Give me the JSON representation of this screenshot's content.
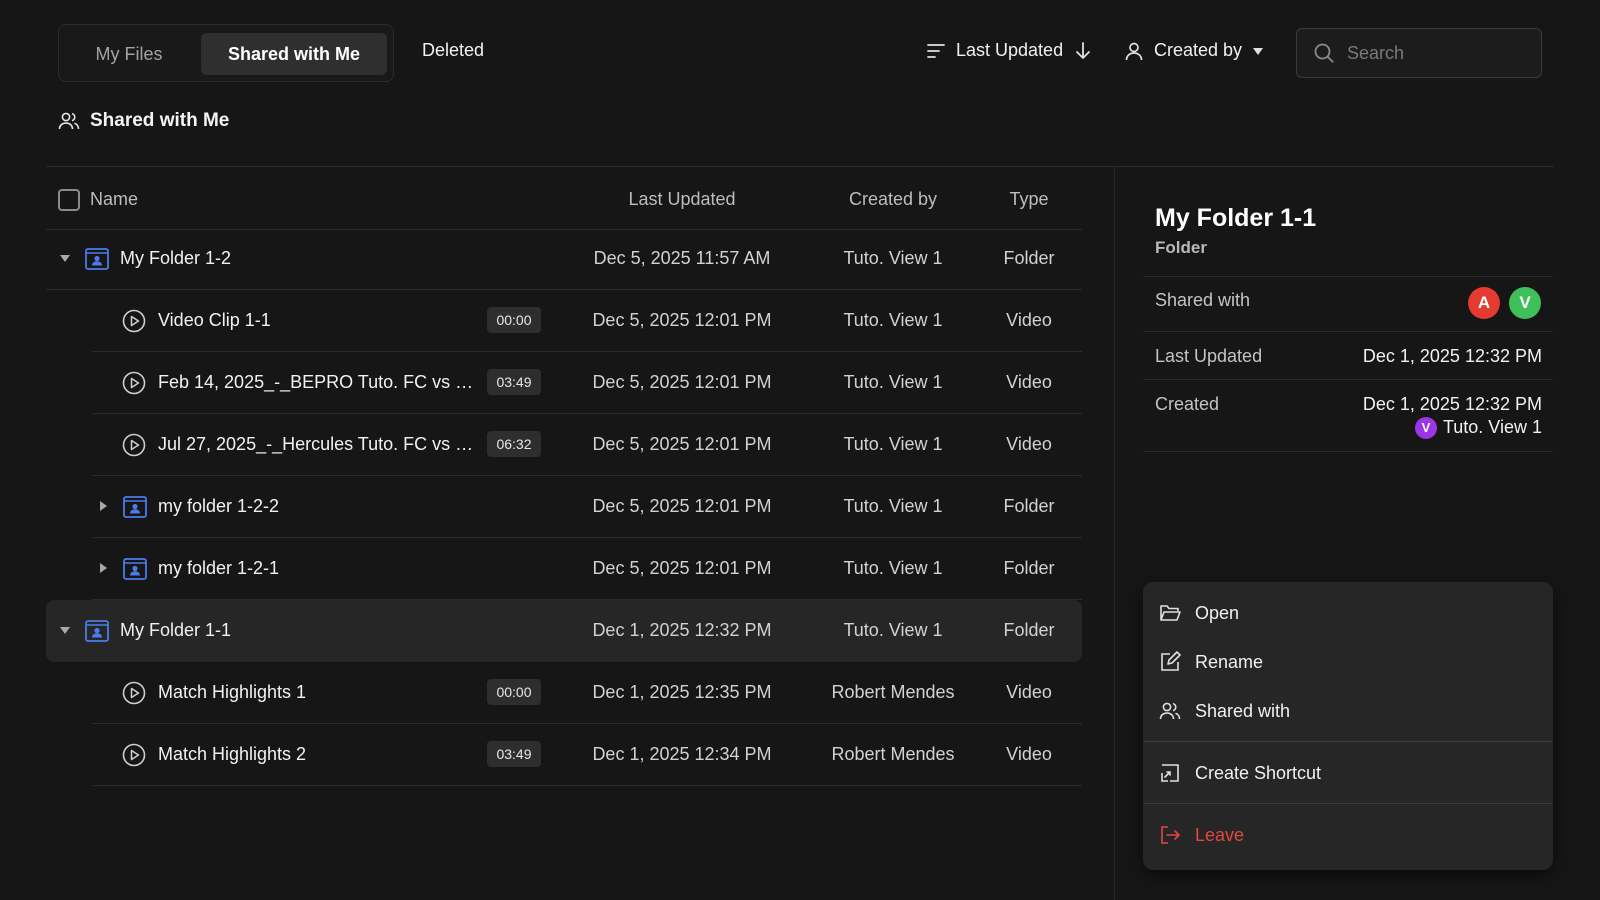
{
  "tabs": [
    {
      "label": "My Files",
      "active": false
    },
    {
      "label": "Shared with Me",
      "active": true
    },
    {
      "label": "Deleted",
      "active": false
    }
  ],
  "toolbar": {
    "sort_label": "Last Updated",
    "created_by_label": "Created by",
    "search_placeholder": "Search"
  },
  "section_title": "Shared with Me",
  "table": {
    "headers": {
      "name": "Name",
      "last_updated": "Last Updated",
      "created_by": "Created by",
      "type": "Type"
    },
    "rows": [
      {
        "name": "My Folder 1-2",
        "kind": "folder",
        "expanded": true,
        "duration": "",
        "last_updated": "Dec 5, 2025 11:57 AM",
        "created_by": "Tuto. View 1",
        "type": "Folder"
      },
      {
        "name": "Video Clip 1-1",
        "kind": "video",
        "duration": "00:00",
        "last_updated": "Dec 5, 2025 12:01 PM",
        "created_by": "Tuto. View 1",
        "type": "Video"
      },
      {
        "name": "Feb 14, 2025_-_BEPRO Tuto. FC vs Cerb...",
        "kind": "video",
        "duration": "03:49",
        "last_updated": "Dec 5, 2025 12:01 PM",
        "created_by": "Tuto. View 1",
        "type": "Video"
      },
      {
        "name": "Jul 27, 2025_-_Hercules Tuto. FC vs BE...",
        "kind": "video",
        "duration": "06:32",
        "last_updated": "Dec 5, 2025 12:01 PM",
        "created_by": "Tuto. View 1",
        "type": "Video"
      },
      {
        "name": "my folder 1-2-2",
        "kind": "folder",
        "expanded": false,
        "duration": "",
        "last_updated": "Dec 5, 2025 12:01 PM",
        "created_by": "Tuto. View 1",
        "type": "Folder"
      },
      {
        "name": "my folder 1-2-1",
        "kind": "folder",
        "expanded": false,
        "duration": "",
        "last_updated": "Dec 5, 2025 12:01 PM",
        "created_by": "Tuto. View 1",
        "type": "Folder"
      },
      {
        "name": "My Folder 1-1",
        "kind": "folder",
        "expanded": true,
        "selected": true,
        "duration": "",
        "last_updated": "Dec 1, 2025 12:32 PM",
        "created_by": "Tuto. View 1",
        "type": "Folder"
      },
      {
        "name": "Match Highlights 1",
        "kind": "video",
        "duration": "00:00",
        "last_updated": "Dec 1, 2025 12:35 PM",
        "created_by": "Robert Mendes",
        "type": "Video"
      },
      {
        "name": "Match Highlights 2",
        "kind": "video",
        "duration": "03:49",
        "last_updated": "Dec 1, 2025 12:34 PM",
        "created_by": "Robert Mendes",
        "type": "Video"
      }
    ]
  },
  "detail": {
    "title": "My Folder 1-1",
    "subtitle": "Folder",
    "shared_with_label": "Shared with",
    "shared_with": [
      {
        "initial": "A",
        "color": "#e53a2f"
      },
      {
        "initial": "V",
        "color": "#3fbf5a"
      }
    ],
    "last_updated_label": "Last Updated",
    "last_updated_value": "Dec 1, 2025 12:32 PM",
    "created_label": "Created",
    "created_value": "Dec 1, 2025 12:32 PM",
    "created_by_initial": "V",
    "created_by_name": "Tuto. View 1"
  },
  "context_menu": {
    "items": [
      {
        "label": "Open",
        "icon": "folder-open-icon"
      },
      {
        "label": "Rename",
        "icon": "edit-icon"
      },
      {
        "label": "Shared with",
        "icon": "users-icon"
      },
      {
        "label": "Create Shortcut",
        "icon": "shortcut-icon"
      },
      {
        "label": "Leave",
        "icon": "leave-icon",
        "danger": true
      }
    ]
  },
  "colors": {
    "background": "#161616",
    "folder_icon": "#4b7bec",
    "danger": "#e0483e",
    "selected_row": "#262626"
  }
}
